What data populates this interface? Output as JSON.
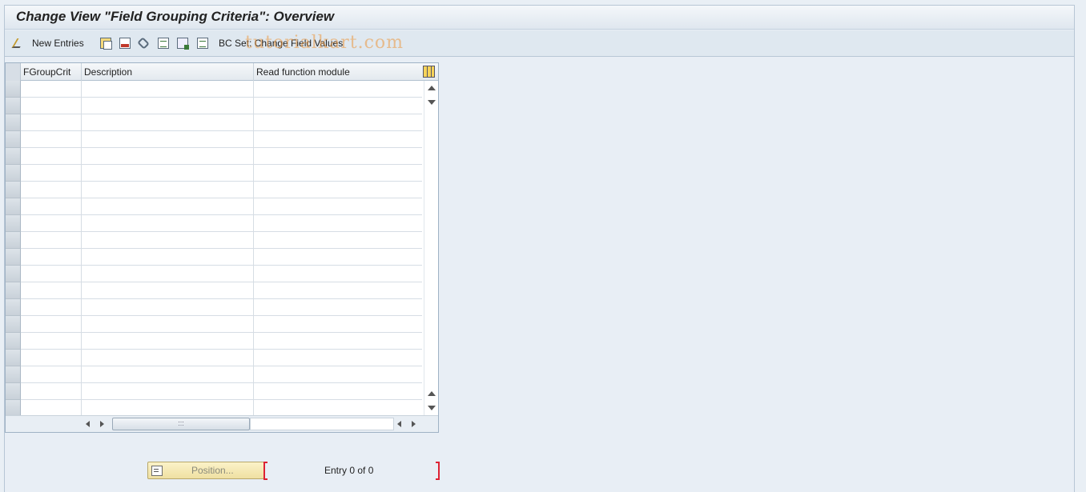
{
  "window": {
    "title": "Change View \"Field Grouping Criteria\": Overview"
  },
  "toolbar": {
    "new_entries_label": "New Entries",
    "bc_set_label": "BC Set: Change Field Values",
    "watermark": "tutorialkart.com",
    "icons": [
      "pencil-icon",
      "copy-icon",
      "delete-icon",
      "undo-icon",
      "select-all-icon",
      "select-block-icon",
      "deselect-all-icon"
    ]
  },
  "table": {
    "columns": [
      "FGroupCrit",
      "Description",
      "Read function module"
    ],
    "row_count": 20,
    "rows": [],
    "scroll_thumb_label": ":::"
  },
  "footer": {
    "position_label": "Position...",
    "entry_text": "Entry 0 of 0"
  },
  "colors": {
    "background": "#e9eff5",
    "toolbar": "#dfe8f0",
    "position_button": "#f4e9b5",
    "bracket": "#dd2233"
  }
}
